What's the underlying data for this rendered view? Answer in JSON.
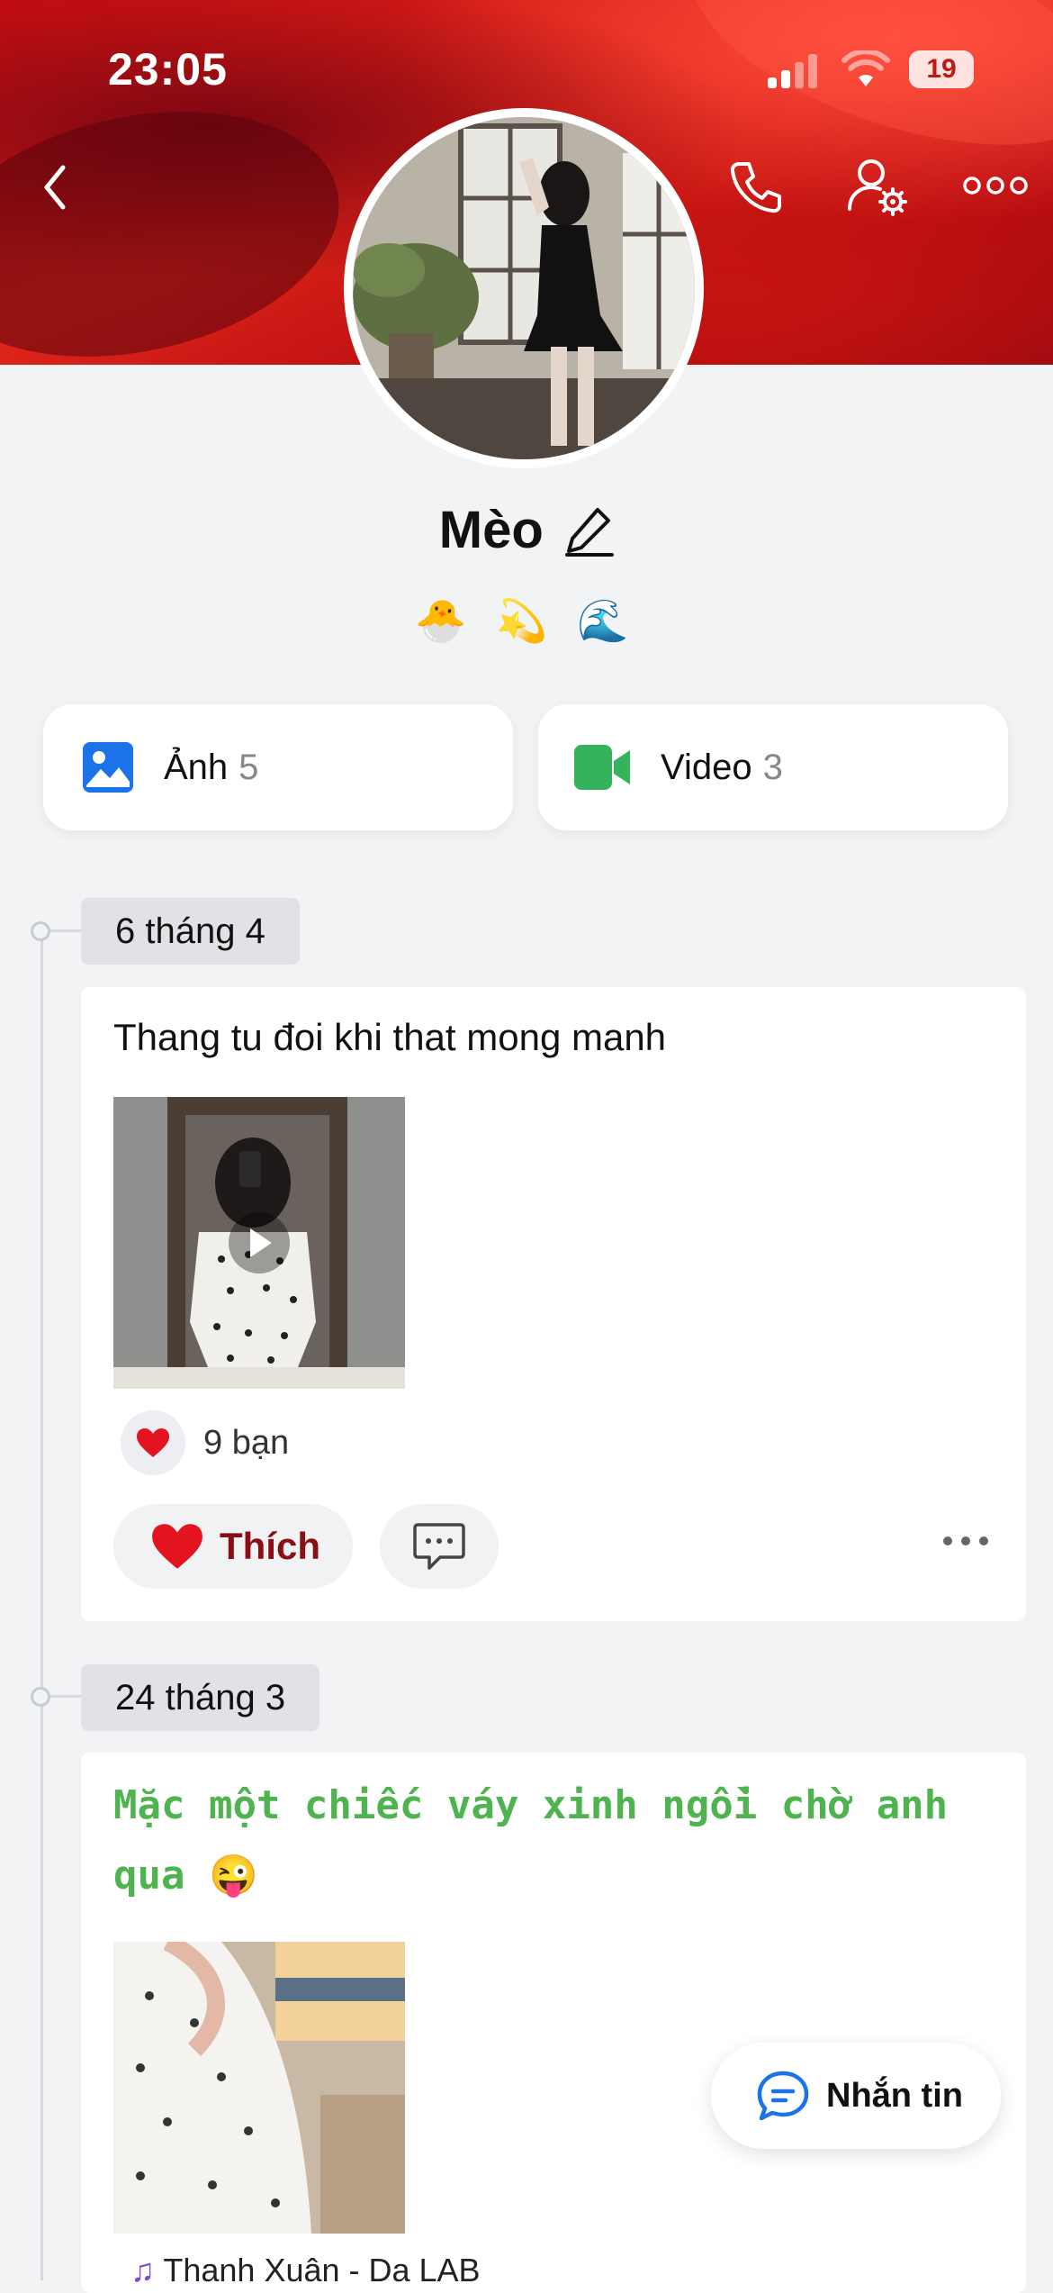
{
  "status_bar": {
    "time": "23:05",
    "battery": "19"
  },
  "header": {
    "back_icon": "chevron-left-icon",
    "call_icon": "phone-icon",
    "settings_icon": "user-gear-icon",
    "more_icon": "more-horizontal-icon"
  },
  "profile": {
    "name": "Mèo",
    "edit_icon": "pencil-icon",
    "emojis": "🐣 💫 🌊"
  },
  "media_tabs": [
    {
      "label": "Ảnh",
      "count": "5",
      "icon": "image-icon",
      "color": "#1a73e8"
    },
    {
      "label": "Video",
      "count": "3",
      "icon": "video-camera-icon",
      "color": "#34b35a"
    }
  ],
  "posts": [
    {
      "date": "6 tháng 4",
      "text": "Thang tu đoi khi that mong manh",
      "media": "video-thumbnail",
      "reactions": "9 bạn",
      "like_label": "Thích"
    },
    {
      "date": "24 tháng 3",
      "text": "Mặc một chiếc váy xinh ngồi chờ anh qua 😜",
      "text_color": "#4fb350",
      "media": "photo-thumbnail",
      "music": "Thanh Xuân - Da LAB"
    }
  ],
  "floating": {
    "message_label": "Nhắn tin"
  }
}
